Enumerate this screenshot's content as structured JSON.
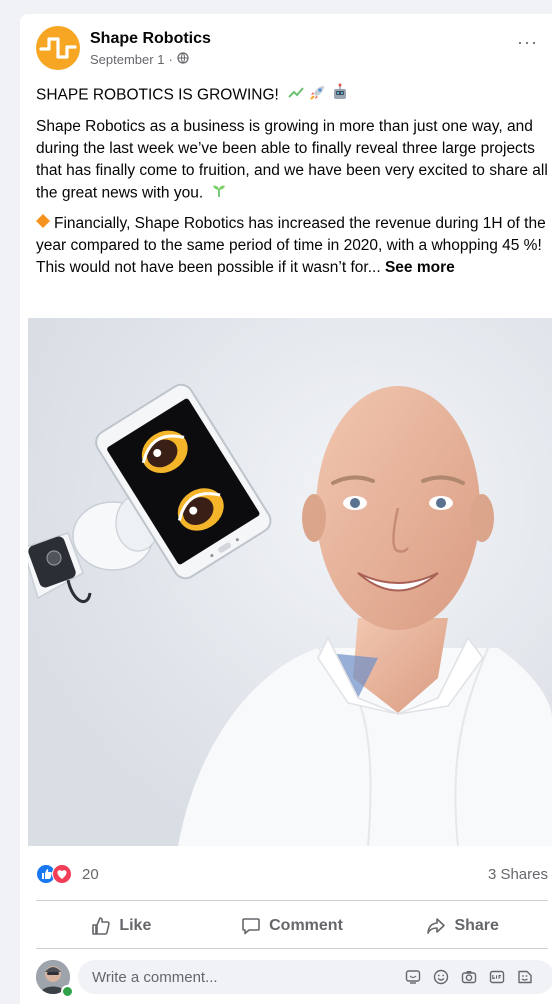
{
  "post": {
    "author": "Shape Robotics",
    "date": "September 1",
    "meta_separator": "·",
    "headline": "SHAPE ROBOTICS IS GROWING!",
    "paragraph1": "Shape Robotics as a business is growing in more than just one way, and during the last week we’ve been able to finally reveal three large projects that has finally come to fruition, and we have been very excited to share all the great news with you.",
    "paragraph2": "Financially, Shape Robotics has increased the revenue during 1H of the year compared to the same period of time in 2020, with a whopping 45 %! This would not have been possible if it wasn’t for...",
    "see_more": "See more",
    "more_menu": "···"
  },
  "stats": {
    "reaction_count": "20",
    "shares": "3 Shares"
  },
  "actions": {
    "like": "Like",
    "comment": "Comment",
    "share": "Share"
  },
  "comment": {
    "placeholder": "Write a comment..."
  },
  "colors": {
    "brand_orange": "#f6a623",
    "like_blue": "#1877f2",
    "love_red": "#f33e58",
    "muted_text": "#65676b"
  },
  "icons": [
    "globe-icon",
    "chart-emoji-icon",
    "rocket-emoji-icon",
    "robot-emoji-icon",
    "seedling-emoji-icon",
    "diamond-emoji-icon",
    "like-reaction-icon",
    "love-reaction-icon",
    "thumbs-up-icon",
    "comment-icon",
    "share-icon",
    "sticker-icon",
    "smiley-icon",
    "camera-icon",
    "gif-icon",
    "avatar-sticker-icon"
  ]
}
